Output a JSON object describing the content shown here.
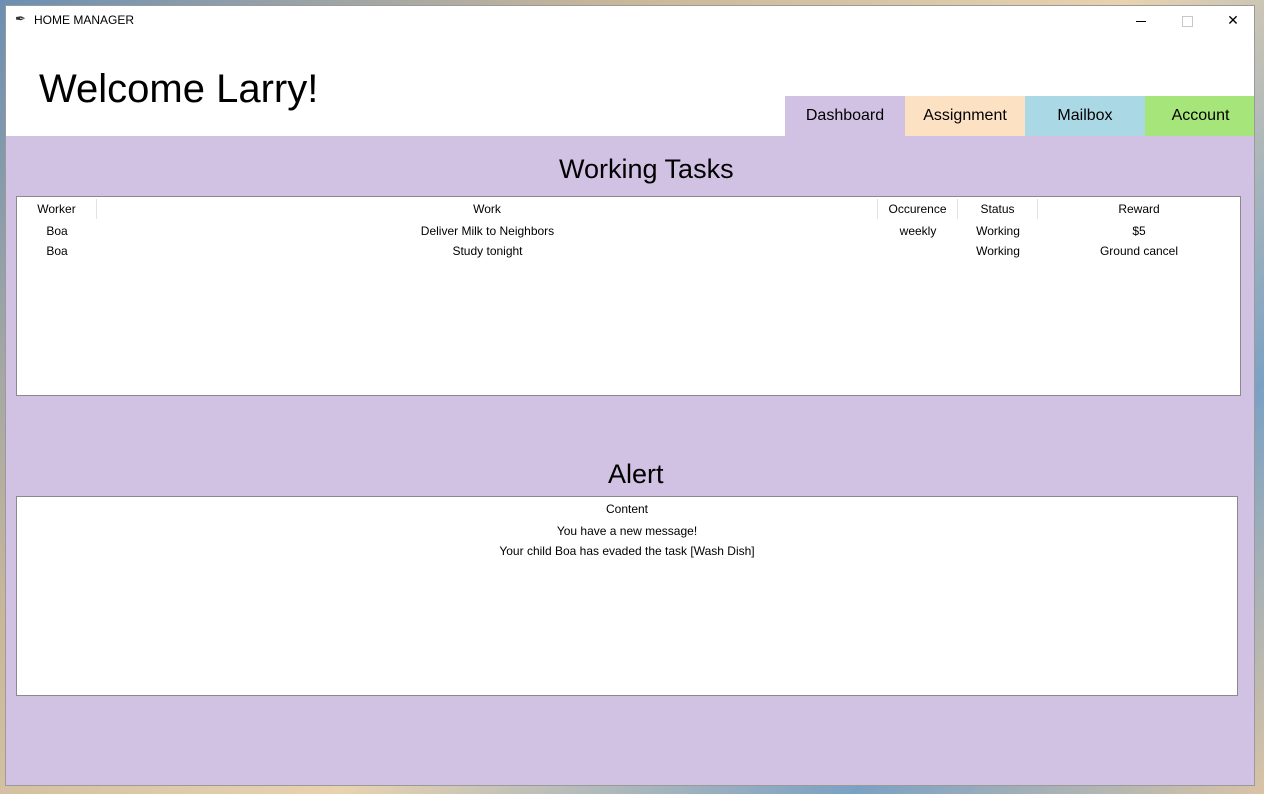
{
  "window": {
    "title": "HOME MANAGER",
    "icon": "feather-icon",
    "controls": {
      "minimize": "minimize",
      "maximize": "maximize",
      "close": "close"
    }
  },
  "header": {
    "welcome": "Welcome Larry!"
  },
  "tabs": [
    {
      "label": "Dashboard",
      "color": "#d1c2e3"
    },
    {
      "label": "Assignment",
      "color": "#fde1c3"
    },
    {
      "label": "Mailbox",
      "color": "#abd8e5"
    },
    {
      "label": "Account",
      "color": "#a5e57a"
    }
  ],
  "colors": {
    "content_background": "#d1c2e3"
  },
  "working_tasks": {
    "title": "Working Tasks",
    "columns": [
      "Worker",
      "Work",
      "Occurence",
      "Status",
      "Reward"
    ],
    "rows": [
      {
        "worker": "Boa",
        "work": "Deliver Milk to Neighbors",
        "occurence": "weekly",
        "status": "Working",
        "reward": "$5"
      },
      {
        "worker": "Boa",
        "work": "Study tonight",
        "occurence": "",
        "status": "Working",
        "reward": "Ground cancel"
      }
    ]
  },
  "alert": {
    "title": "Alert",
    "columns": [
      "Content"
    ],
    "rows": [
      {
        "content": "You have a new message!"
      },
      {
        "content": "Your child Boa has evaded the task [Wash Dish]"
      }
    ]
  }
}
